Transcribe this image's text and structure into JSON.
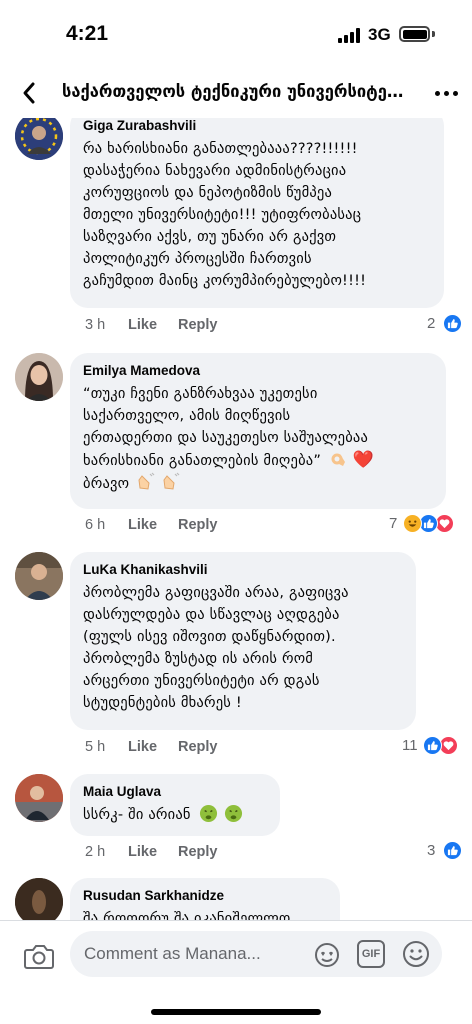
{
  "status_bar": {
    "time": "4:21",
    "network": "3G"
  },
  "nav": {
    "title": "საქართველოს ტექნიკური უნივერსიტეტ..."
  },
  "comments": [
    {
      "author": "Giga Zurabashvili",
      "text": "რა ხარისხიანი განათლებააა????!!!!!!\nდასაჭერია ნახევარი ადმინისტრაცია\nკორუფციოს და ნეპოტიზმის წუმპეა\nმთელი უნივერსიტეტი!!! უტიფრობასაც\nსაზღვარი აქვს, თუ უნარი არ გაქვთ\nპოლიტიკურ პროცესში ჩართვის\nგაჩუმდით მაინც კორუმპირებულებო!!!!",
      "time": "3 h",
      "like": "Like",
      "reply": "Reply",
      "reaction_count": "2",
      "reactions": [
        "like"
      ]
    },
    {
      "author": "Emilya Mamedova",
      "text_lines": [
        "“თუკი ჩვენი განზრახვაა უკეთესი",
        "საქართველო, ამის მიღწევის",
        "ერთადერთი და საუკეთესო საშუალებაა",
        "ხარისხიანი განათლების მიღება”"
      ],
      "text_last": "ბრავო",
      "time": "6 h",
      "like": "Like",
      "reply": "Reply",
      "reaction_count": "7",
      "reactions": [
        "haha",
        "like",
        "love"
      ]
    },
    {
      "author": "LuKa Khanikashvili",
      "text": "პრობლემა გაფიცვაში არაა, გაფიცვა\nდასრულდება და სწავლაც აღდგება\n(ფულს ისევ იშოვით დაწყნარდით).\nპრობლემა ზუსტად ის არის რომ\nარცერთი უნივერსიტეტი არ დგას\nსტუდენტების მხარეს !",
      "time": "5 h",
      "like": "Like",
      "reply": "Reply",
      "reaction_count": "11",
      "reactions": [
        "like",
        "love"
      ]
    },
    {
      "author": "Maia Uglava",
      "text": "სსრკ- ში არიან",
      "time": "2 h",
      "like": "Like",
      "reply": "Reply",
      "reaction_count": "3",
      "reactions": [
        "like"
      ]
    },
    {
      "author": "Rusudan Sarkhanidze",
      "text": "შა როოორუ შა იკანიშელლო"
    }
  ],
  "composer": {
    "placeholder": "Comment as Manana...",
    "gif_label": "GIF"
  },
  "colors": {
    "like": "#1877f2",
    "love": "#f33e58",
    "haha": "#f7b125",
    "bubble": "#f0f2f5",
    "meta": "#65676b"
  }
}
